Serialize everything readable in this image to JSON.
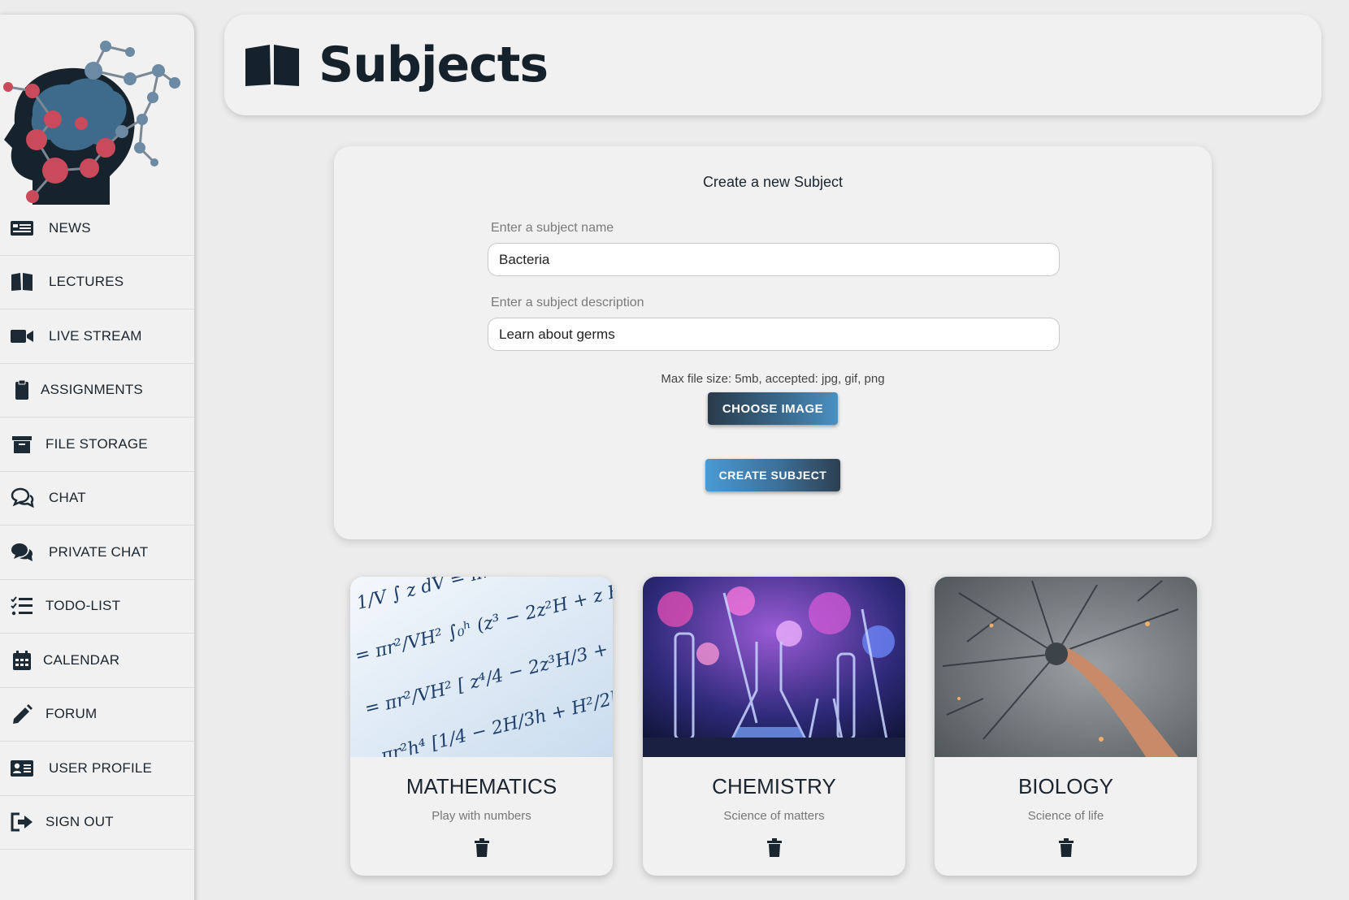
{
  "sidebar": {
    "items": [
      {
        "label": "NEWS",
        "icon": "newspaper-icon"
      },
      {
        "label": "LECTURES",
        "icon": "book-open-icon"
      },
      {
        "label": "LIVE STREAM",
        "icon": "video-camera-icon"
      },
      {
        "label": "ASSIGNMENTS",
        "icon": "clipboard-icon"
      },
      {
        "label": "FILE STORAGE",
        "icon": "archive-box-icon"
      },
      {
        "label": "CHAT",
        "icon": "chat-bubbles-icon"
      },
      {
        "label": "PRIVATE CHAT",
        "icon": "private-chat-icon"
      },
      {
        "label": "TODO-LIST",
        "icon": "tasks-list-icon"
      },
      {
        "label": "CALENDAR",
        "icon": "calendar-icon"
      },
      {
        "label": "FORUM",
        "icon": "pencil-icon"
      },
      {
        "label": "USER PROFILE",
        "icon": "id-card-icon"
      },
      {
        "label": "SIGN OUT",
        "icon": "sign-out-icon"
      }
    ]
  },
  "header": {
    "title": "Subjects",
    "icon": "book-open-icon"
  },
  "form": {
    "title": "Create a new Subject",
    "name_label": "Enter a subject name",
    "name_value": "Bacteria",
    "description_label": "Enter a subject description",
    "description_value": "Learn about germs",
    "file_note": "Max file size: 5mb, accepted: jpg, gif, png",
    "choose_image_label": "CHOOSE IMAGE",
    "create_label": "CREATE SUBJECT"
  },
  "subjects": [
    {
      "name": "MATHEMATICS",
      "description": "Play with numbers"
    },
    {
      "name": "CHEMISTRY",
      "description": "Science of matters"
    },
    {
      "name": "BIOLOGY",
      "description": "Science of life"
    }
  ],
  "colors": {
    "accent_dark": "#1c2a35",
    "accent_blue": "#4a90c2",
    "background": "#ececec",
    "panel": "#f1f1f1"
  }
}
